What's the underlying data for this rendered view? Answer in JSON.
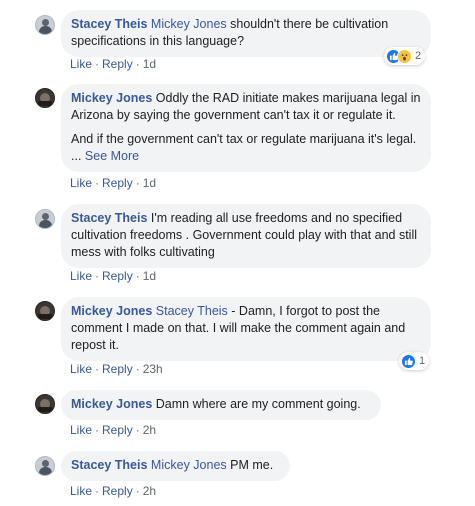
{
  "comments": [
    {
      "author": "Stacey Theis",
      "tagged": "Mickey Jones",
      "text": " shouldn't there be cultivation specifications in this language?",
      "actions": {
        "like": "Like",
        "reply": "Reply",
        "time": "1d"
      },
      "reactions": {
        "types": [
          "like",
          "wow"
        ],
        "count": "2"
      }
    },
    {
      "author": "Mickey Jones",
      "text": " Oddly the RAD initiate makes marijuana legal in Arizona by saying the government can't tax it or regulate it.",
      "text2": "And if the government can't tax or regulate marijuana it's legal. ...",
      "see_more": "See More",
      "actions": {
        "like": "Like",
        "reply": "Reply",
        "time": "1d"
      }
    },
    {
      "author": "Stacey Theis",
      "text": " I'm reading all use freedoms and no specified cultivation freedoms . Government could play with that and still mess with folks cultivating",
      "actions": {
        "like": "Like",
        "reply": "Reply",
        "time": "1d"
      }
    },
    {
      "author": "Mickey Jones",
      "tagged": "Stacey Theis",
      "text": " - Damn, I forgot to post the comment I made on that. I will make the comment again and repost it.",
      "actions": {
        "like": "Like",
        "reply": "Reply",
        "time": "23h"
      },
      "reactions": {
        "types": [
          "like"
        ],
        "count": "1"
      }
    },
    {
      "author": "Mickey Jones",
      "text": " Damn where are my comment going.",
      "actions": {
        "like": "Like",
        "reply": "Reply",
        "time": "2h"
      }
    },
    {
      "author": "Stacey Theis",
      "tagged": "Mickey Jones",
      "text": " PM me.",
      "actions": {
        "like": "Like",
        "reply": "Reply",
        "time": "2h"
      }
    }
  ],
  "colors": {
    "link": "#385898",
    "bubble": "#f2f3f5",
    "meta": "#606770",
    "like": "#1877f2",
    "wow": "#f7c438"
  },
  "icons": {
    "like": "thumbs-up-icon",
    "wow": "wow-face-icon"
  }
}
